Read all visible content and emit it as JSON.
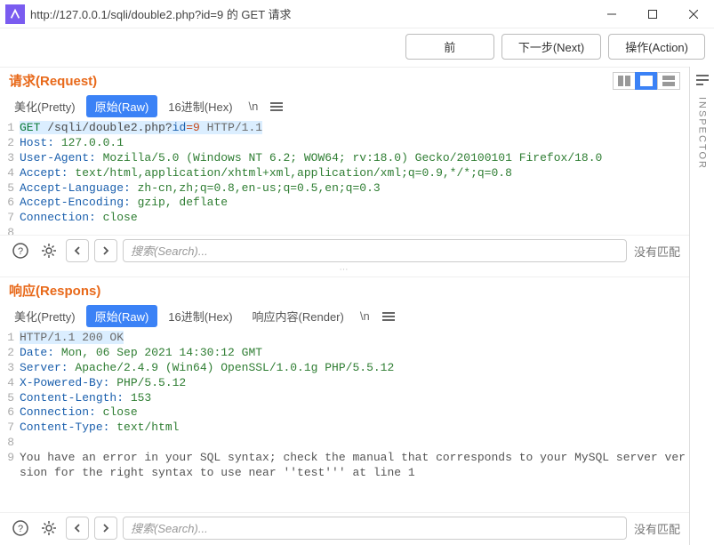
{
  "window": {
    "title": "http://127.0.0.1/sqli/double2.php?id=9 的 GET 请求"
  },
  "toolbar": {
    "back": "前",
    "next": "下一步(Next)",
    "action": "操作(Action)"
  },
  "inspector": {
    "label": "INSPECTOR"
  },
  "request": {
    "title": "请求(Request)",
    "tabs": {
      "pretty": "美化(Pretty)",
      "raw": "原始(Raw)",
      "hex": "16进制(Hex)",
      "nl": "\\n"
    },
    "lines": {
      "l1": {
        "method": "GET",
        "path_pre": " /sqli/double2.php?",
        "qkey": "id",
        "qval": "=9",
        "proto": " HTTP/1.1"
      },
      "l2": {
        "name": "Host:",
        "value": " 127.0.0.1"
      },
      "l3": {
        "name": "User-Agent:",
        "value": " Mozilla/5.0 (Windows NT 6.2; WOW64; rv:18.0) Gecko/20100101 Firefox/18.0"
      },
      "l4": {
        "name": "Accept:",
        "value": " text/html,application/xhtml+xml,application/xml;q=0.9,*/*;q=0.8"
      },
      "l5": {
        "name": "Accept-Language:",
        "value": " zh-cn,zh;q=0.8,en-us;q=0.5,en;q=0.3"
      },
      "l6": {
        "name": "Accept-Encoding:",
        "value": " gzip, deflate"
      },
      "l7": {
        "name": "Connection:",
        "value": " close"
      }
    },
    "search_placeholder": "搜索(Search)...",
    "nomatch": "没有匹配"
  },
  "response": {
    "title": "响应(Respons)",
    "tabs": {
      "pretty": "美化(Pretty)",
      "raw": "原始(Raw)",
      "hex": "16进制(Hex)",
      "render": "响应内容(Render)",
      "nl": "\\n"
    },
    "lines": {
      "l1": "HTTP/1.1 200 OK",
      "l2": {
        "name": "Date:",
        "value": " Mon, 06 Sep 2021 14:30:12 GMT"
      },
      "l3": {
        "name": "Server:",
        "value": " Apache/2.4.9 (Win64) OpenSSL/1.0.1g PHP/5.5.12"
      },
      "l4": {
        "name": "X-Powered-By:",
        "value": " PHP/5.5.12"
      },
      "l5": {
        "name": "Content-Length:",
        "value": " 153"
      },
      "l6": {
        "name": "Connection:",
        "value": " close"
      },
      "l7": {
        "name": "Content-Type:",
        "value": " text/html"
      },
      "l9": "You have an error in your SQL syntax; check the manual that corresponds to your MySQL server version for the right syntax to use near ''test''' at line 1"
    },
    "search_placeholder": "搜索(Search)...",
    "nomatch": "没有匹配"
  }
}
